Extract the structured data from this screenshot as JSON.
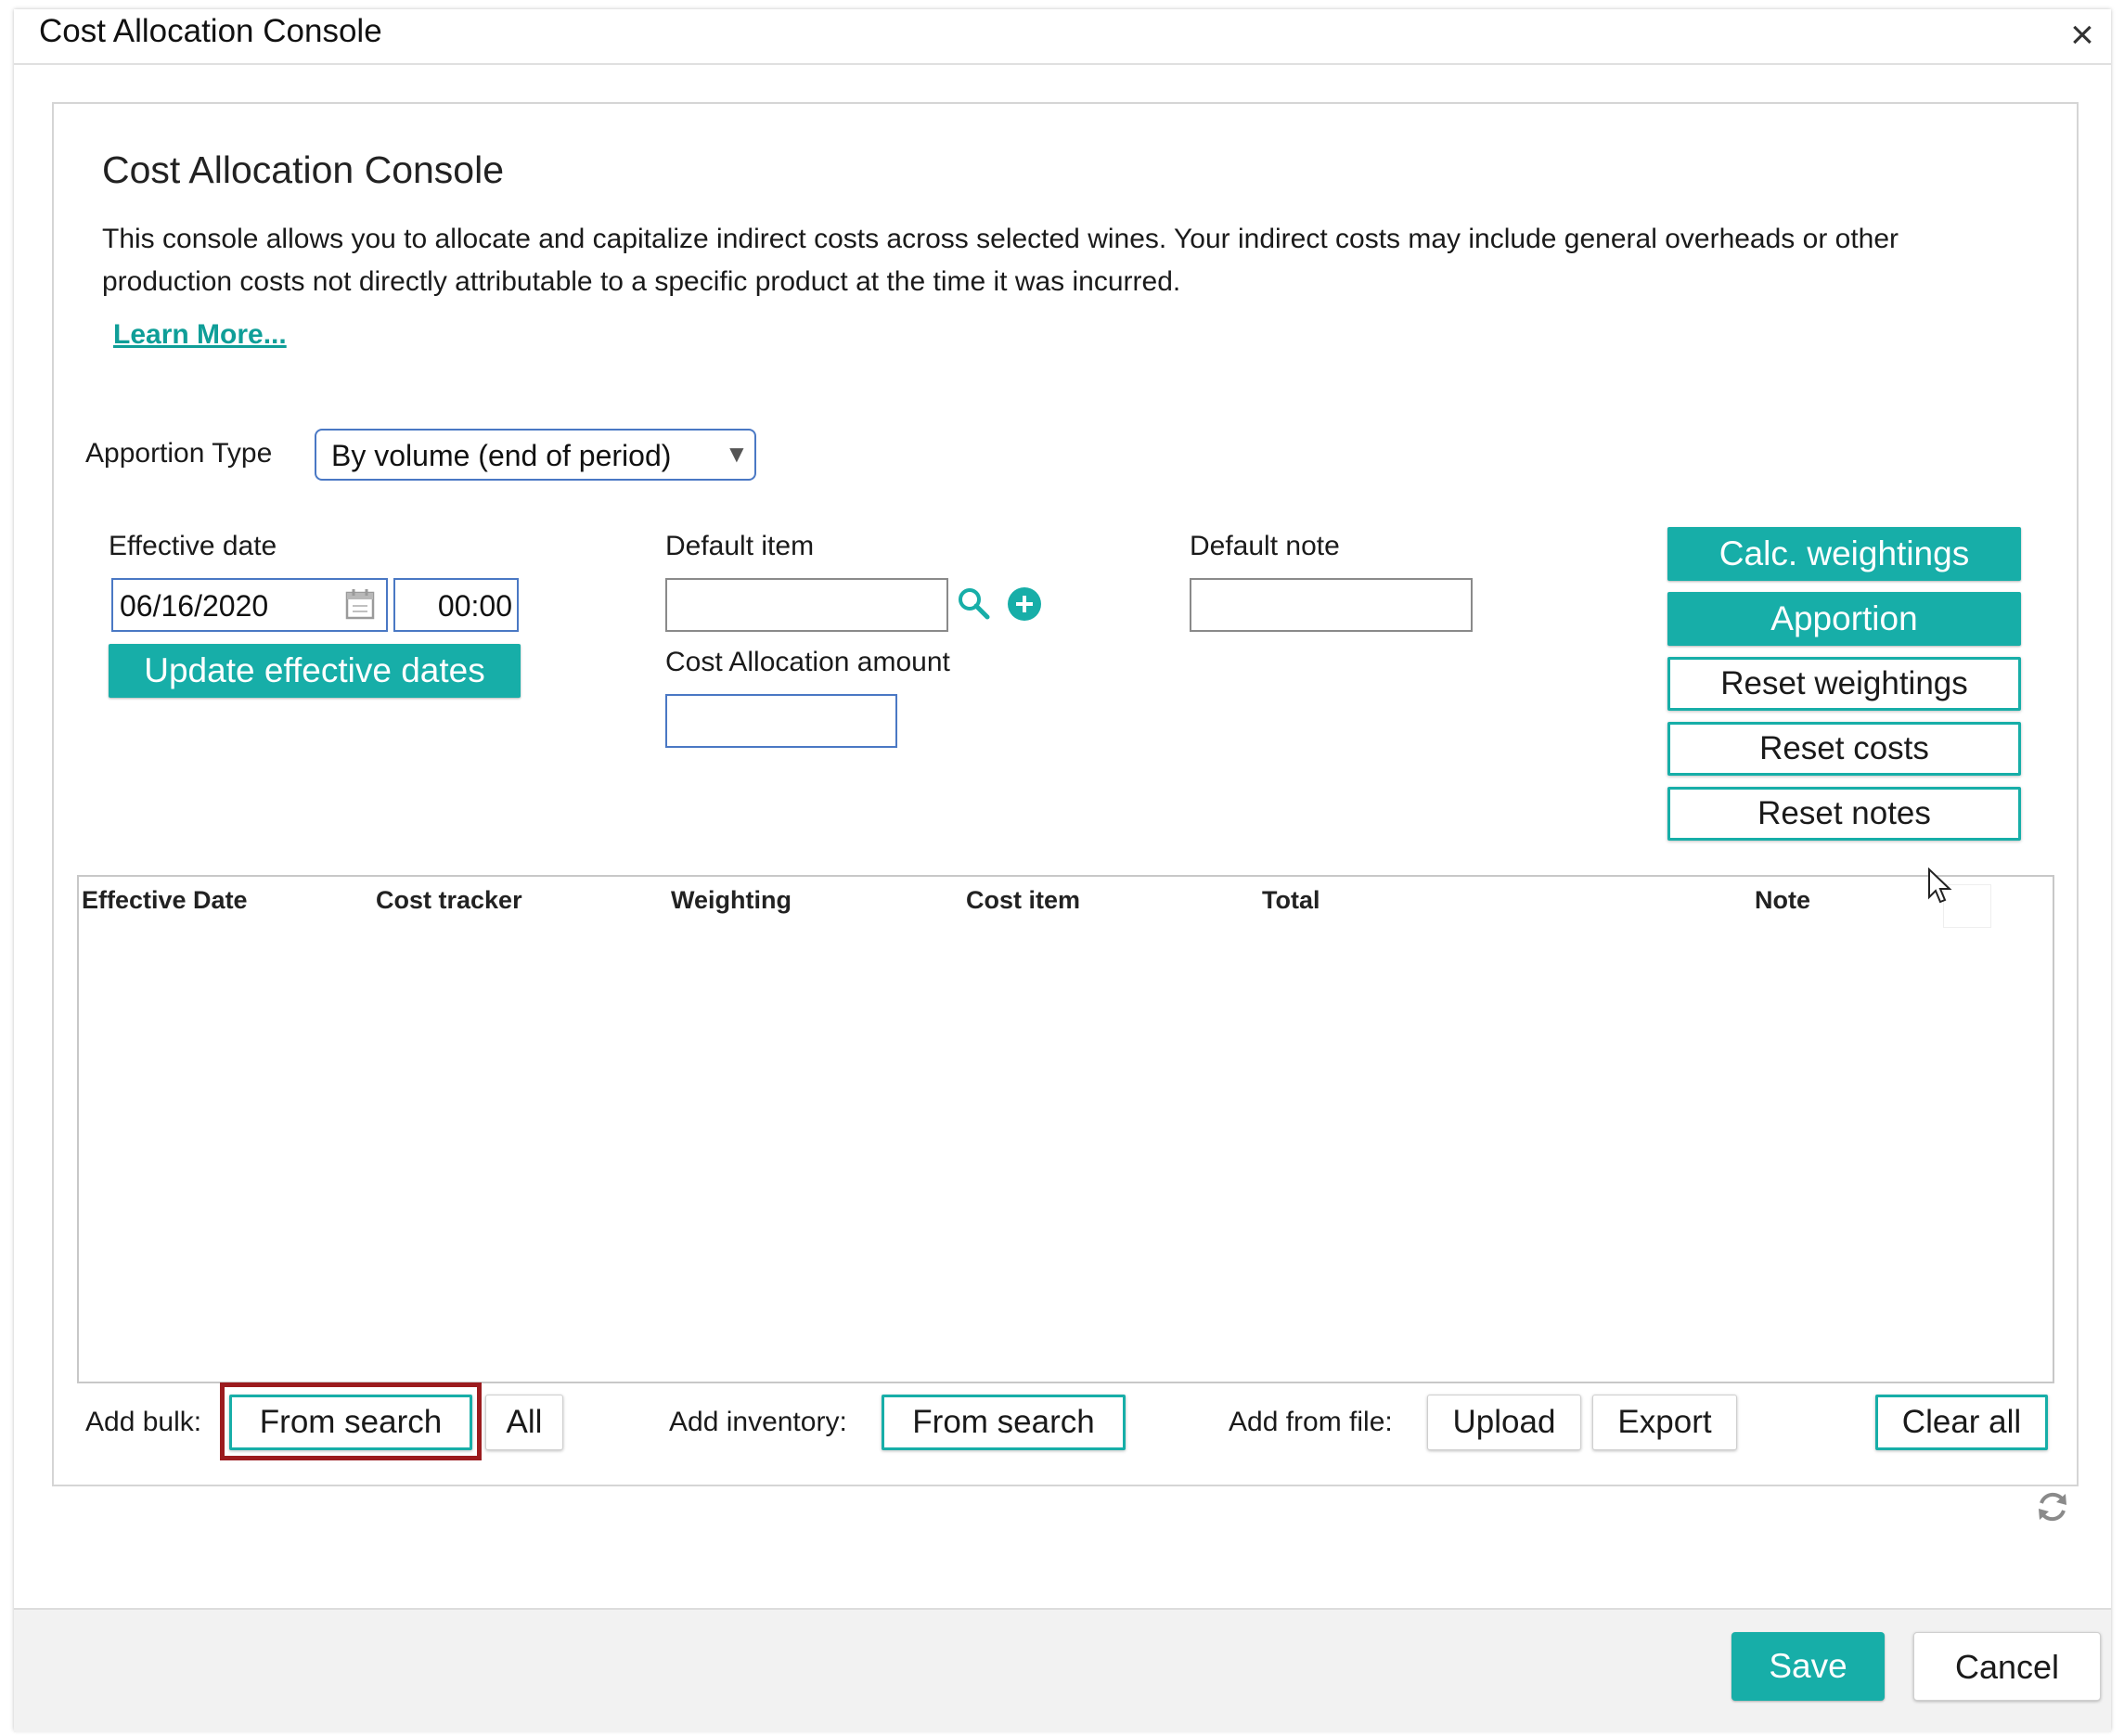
{
  "window": {
    "title": "Cost Allocation Console"
  },
  "intro": {
    "heading": "Cost Allocation Console",
    "description": "This console allows you to allocate and capitalize indirect costs across selected wines. Your indirect costs may include general overheads or other production costs not directly attributable to a specific product at the time it was incurred.",
    "learn_more": "Learn More..."
  },
  "apportion": {
    "label": "Apportion Type",
    "value": "By volume (end of period)"
  },
  "effective_date": {
    "label": "Effective date",
    "date_value": "06/16/2020",
    "time_value": "00:00",
    "update_button": "Update effective dates"
  },
  "default_item": {
    "label": "Default item",
    "value": ""
  },
  "cost_amount": {
    "label": "Cost Allocation amount",
    "value": ""
  },
  "default_note": {
    "label": "Default note",
    "value": ""
  },
  "actions": {
    "calc": "Calc. weightings",
    "apportion": "Apportion",
    "reset_weightings": "Reset weightings",
    "reset_costs": "Reset costs",
    "reset_notes": "Reset notes"
  },
  "grid": {
    "columns": [
      "Effective Date",
      "Cost tracker",
      "Weighting",
      "Cost item",
      "Total",
      "Note"
    ]
  },
  "bottom": {
    "add_bulk_label": "Add bulk:",
    "bulk_from_search": "From search",
    "bulk_all": "All",
    "add_inventory_label": "Add inventory:",
    "inventory_from_search": "From search",
    "add_from_file_label": "Add from file:",
    "upload": "Upload",
    "export": "Export",
    "clear_all": "Clear all"
  },
  "footer": {
    "save": "Save",
    "cancel": "Cancel"
  },
  "colors": {
    "accent": "#17aea8",
    "highlight": "#9b1b1e",
    "input_focus": "#4a78c4"
  }
}
